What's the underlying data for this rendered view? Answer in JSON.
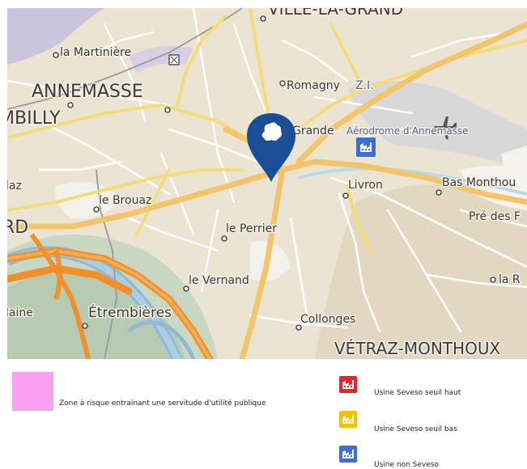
{
  "map": {
    "places": [
      {
        "name": "la Martinière"
      },
      {
        "name": "ANNEMASSE"
      },
      {
        "name": "MBILLY"
      },
      {
        "name": "Romagny"
      },
      {
        "name": "Z.I."
      },
      {
        "name": "Aérodrome d'Annemasse"
      },
      {
        "name": "Grande"
      },
      {
        "name": "Livron"
      },
      {
        "name": "Bas Monthou"
      },
      {
        "name": "Pré des F"
      },
      {
        "name": "le Brouaz"
      },
      {
        "name": "laz"
      },
      {
        "name": "RD"
      },
      {
        "name": "le Perrier"
      },
      {
        "name": "le Vernand"
      },
      {
        "name": "la R"
      },
      {
        "name": "laine"
      },
      {
        "name": "Étrembières"
      },
      {
        "name": "Collonges"
      },
      {
        "name": "VÉTRAZ-MONTHOUX"
      },
      {
        "name": "VILLE-LA-GRAND"
      }
    ],
    "marker_color": "#1a4f96"
  },
  "legend": {
    "zone_label": "Zone à risque entrainant une servitude d'utilité publique",
    "zone_color": "#f8a0f2",
    "items": [
      {
        "label": "Usine Seveso seuil haut",
        "color": "#e8242a",
        "icon": "factory-icon"
      },
      {
        "label": "Usine Seveso seuil bas",
        "color": "#f2c100",
        "icon": "factory-icon"
      },
      {
        "label": "Usine non Seveso",
        "color": "#3b6fd4",
        "icon": "factory-icon"
      }
    ]
  }
}
